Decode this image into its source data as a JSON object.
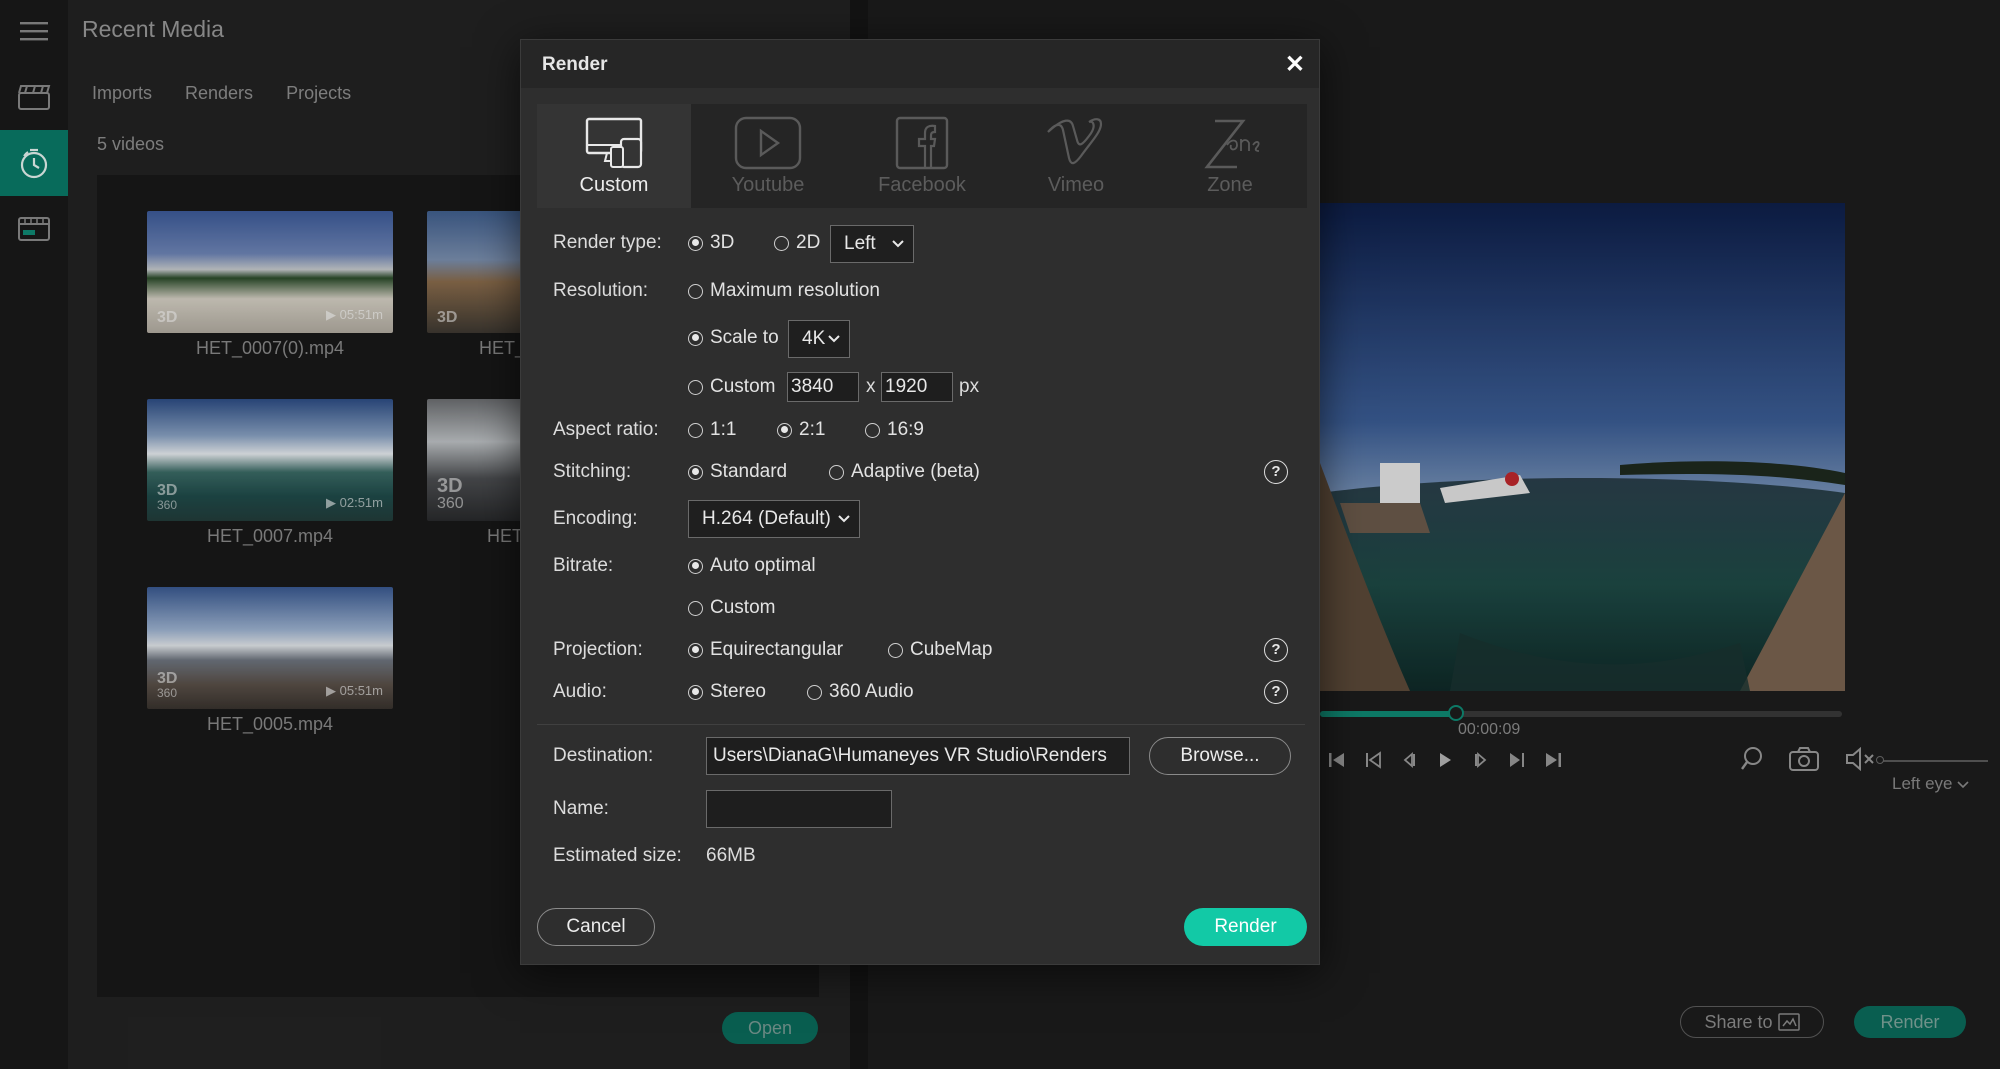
{
  "left_panel": {
    "title": "Recent Media",
    "tabs": [
      "Imports",
      "Renders",
      "Projects"
    ],
    "count": "5 videos",
    "items": [
      {
        "name": "HET_0007(0).mp4",
        "badge": "3D",
        "badge_sub": "",
        "duration": "▶ 05:51m"
      },
      {
        "name": "HET_(",
        "badge": "3D",
        "badge_sub": "",
        "duration": ""
      },
      {
        "name": "HET_0007.mp4",
        "badge": "3D",
        "badge_sub": "360",
        "duration": "▶ 02:51m"
      },
      {
        "name": "HET",
        "badge": "3D",
        "badge_sub": "360",
        "duration": ""
      },
      {
        "name": "HET_0005.mp4",
        "badge": "3D",
        "badge_sub": "360",
        "duration": "▶ 05:51m"
      }
    ],
    "open_label": "Open"
  },
  "right_panel": {
    "timecode": "00:00:09",
    "progress": 0.26,
    "eye_select": "Left eye",
    "share_label": "Share to",
    "render_label": "Render"
  },
  "dialog": {
    "title": "Render",
    "close": "✕",
    "platforms": [
      {
        "label": "Custom",
        "icon": "devices-icon",
        "active": true
      },
      {
        "label": "Youtube",
        "icon": "youtube-icon",
        "active": false
      },
      {
        "label": "Facebook",
        "icon": "facebook-icon",
        "active": false
      },
      {
        "label": "Vimeo",
        "icon": "vimeo-icon",
        "active": false
      },
      {
        "label": "Zone",
        "icon": "zone-icon",
        "active": false
      }
    ],
    "render_type": {
      "label": "Render type:",
      "opt_3d": "3D",
      "opt_2d": "2D",
      "eye": "Left"
    },
    "resolution": {
      "label": "Resolution:",
      "max": "Maximum resolution",
      "scale": "Scale to",
      "scale_value": "4K",
      "custom": "Custom",
      "width": "3840",
      "x": "x",
      "height": "1920",
      "unit": "px"
    },
    "aspect": {
      "label": "Aspect ratio:",
      "a": "1:1",
      "b": "2:1",
      "c": "16:9"
    },
    "stitching": {
      "label": "Stitching:",
      "standard": "Standard",
      "adaptive": "Adaptive (beta)"
    },
    "encoding": {
      "label": "Encoding:",
      "value": "H.264 (Default)"
    },
    "bitrate": {
      "label": "Bitrate:",
      "auto": "Auto optimal",
      "custom": "Custom"
    },
    "projection": {
      "label": "Projection:",
      "equi": "Equirectangular",
      "cube": "CubeMap"
    },
    "audio": {
      "label": "Audio:",
      "stereo": "Stereo",
      "a360": "360 Audio"
    },
    "help": "?",
    "destination": {
      "label": "Destination:",
      "value": "Users\\DianaG\\Humaneyes VR Studio\\Renders",
      "browse": "Browse..."
    },
    "name": {
      "label": "Name:",
      "value": ""
    },
    "size": {
      "label": "Estimated size:",
      "value": "66MB"
    },
    "cancel": "Cancel",
    "render": "Render"
  },
  "colors": {
    "accent": "#12c9a6",
    "accent_dark": "#0b6b5c",
    "dialog_bg": "#2e2e2e"
  }
}
